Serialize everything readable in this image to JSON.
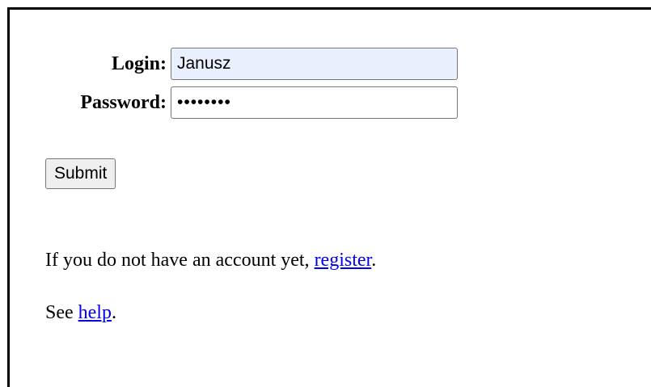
{
  "form": {
    "login_label": "Login:",
    "login_value": "Janusz",
    "password_label": "Password:",
    "password_value": "secret12",
    "submit_label": "Submit"
  },
  "register_text": {
    "before": "If you do not have an account yet, ",
    "link": "register",
    "after": "."
  },
  "help_text": {
    "before": "See ",
    "link": "help",
    "after": "."
  },
  "colors": {
    "link": "#0000ee",
    "autofill_bg": "#e8f0fe",
    "button_bg": "#efefef",
    "frame_border": "#000000"
  }
}
